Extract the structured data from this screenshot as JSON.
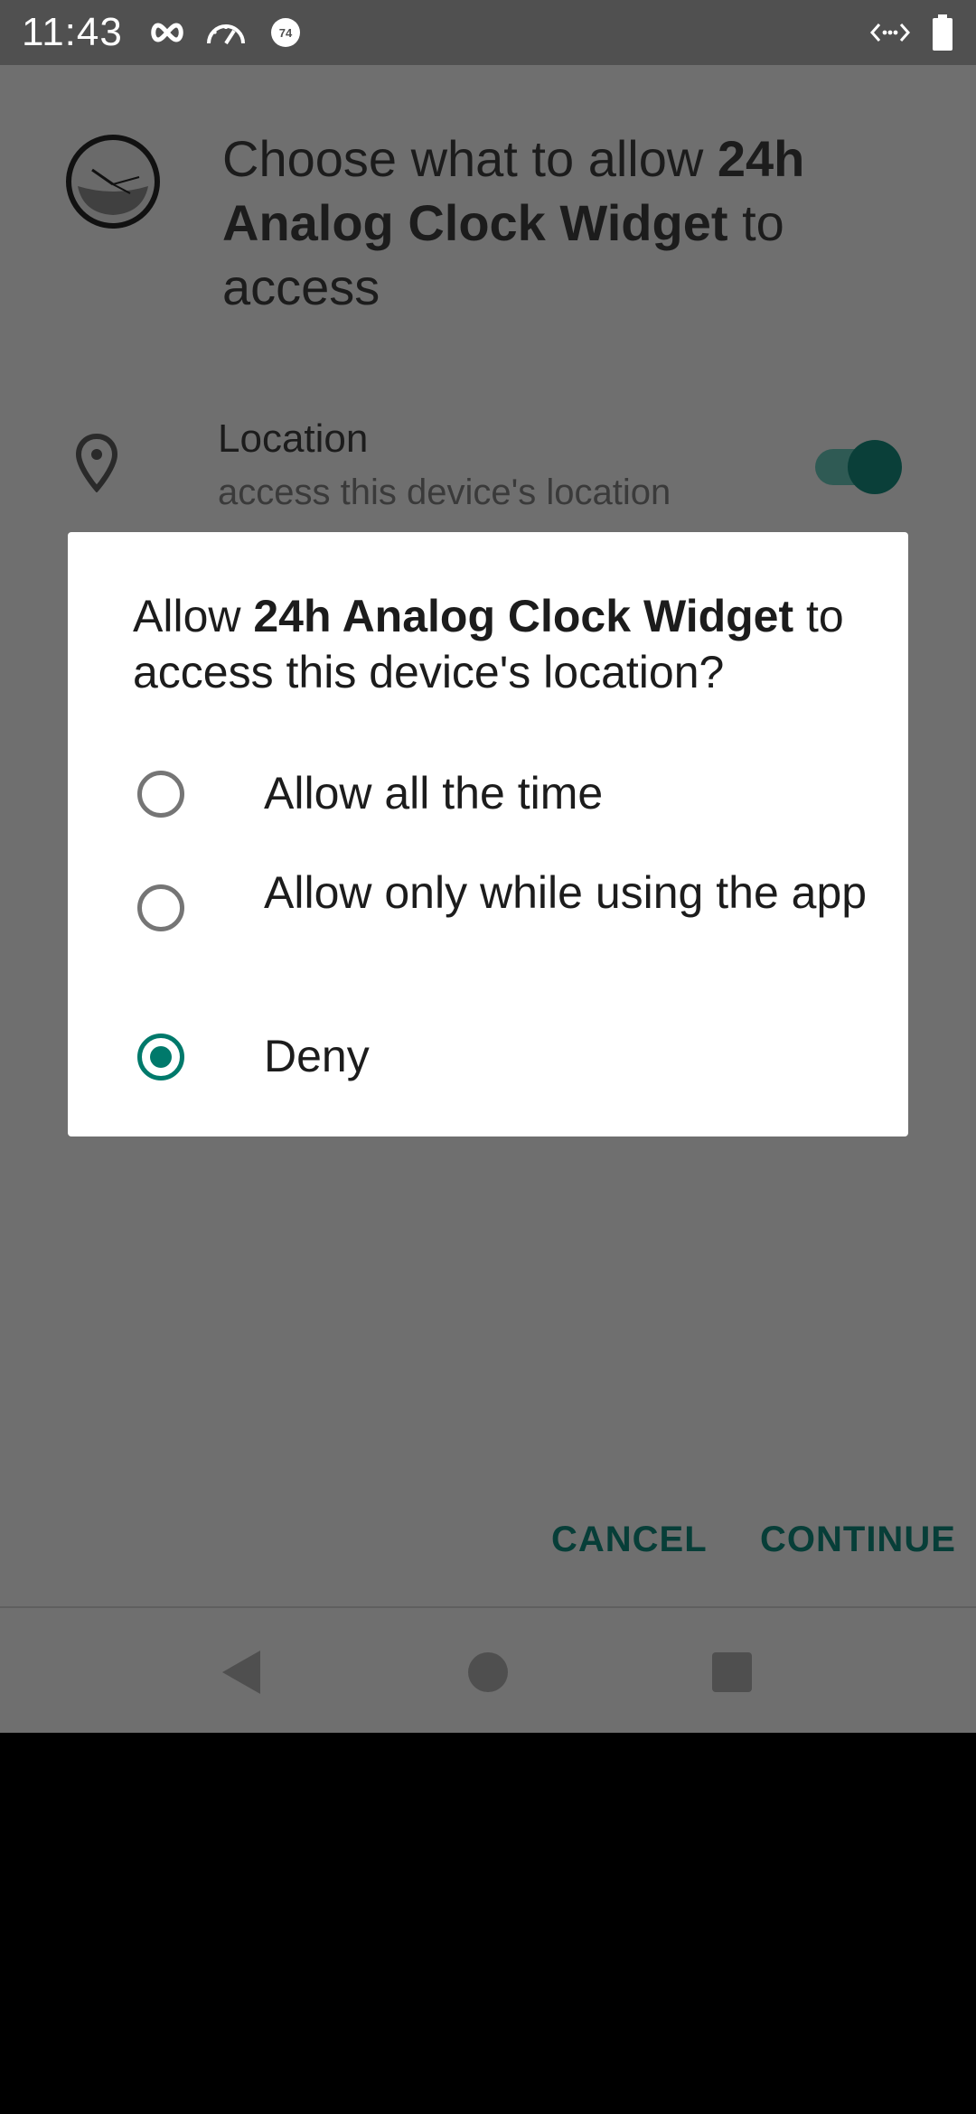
{
  "status_bar": {
    "time": "11:43",
    "icons": [
      "infinity-icon",
      "speedometer-icon",
      "badge-74-icon",
      "code-arrows-icon",
      "battery-icon"
    ],
    "badge_number": "74"
  },
  "header": {
    "title_prefix": "Choose what to allow ",
    "app_name": "24h Analog Clock Widget",
    "title_suffix": " to access"
  },
  "permission": {
    "title": "Location",
    "subtitle": "access this device's location",
    "icon": "location-pin-icon",
    "enabled": true
  },
  "dialog": {
    "title_prefix": "Allow ",
    "app_name": "24h Analog Clock Widget",
    "title_suffix": " to access this device's location?",
    "options": [
      {
        "label": "Allow all the time",
        "selected": false
      },
      {
        "label": "Allow only while using the app",
        "selected": false
      },
      {
        "label": "Deny",
        "selected": true
      }
    ]
  },
  "actions": {
    "cancel": "CANCEL",
    "continue": "CONTINUE"
  },
  "navigation": {
    "icons": [
      "back-icon",
      "home-icon",
      "recents-icon"
    ]
  },
  "colors": {
    "accent": "#00796b",
    "button_text": "#073e38",
    "scrim": "#6f6f6f",
    "status_bar": "#505050"
  }
}
